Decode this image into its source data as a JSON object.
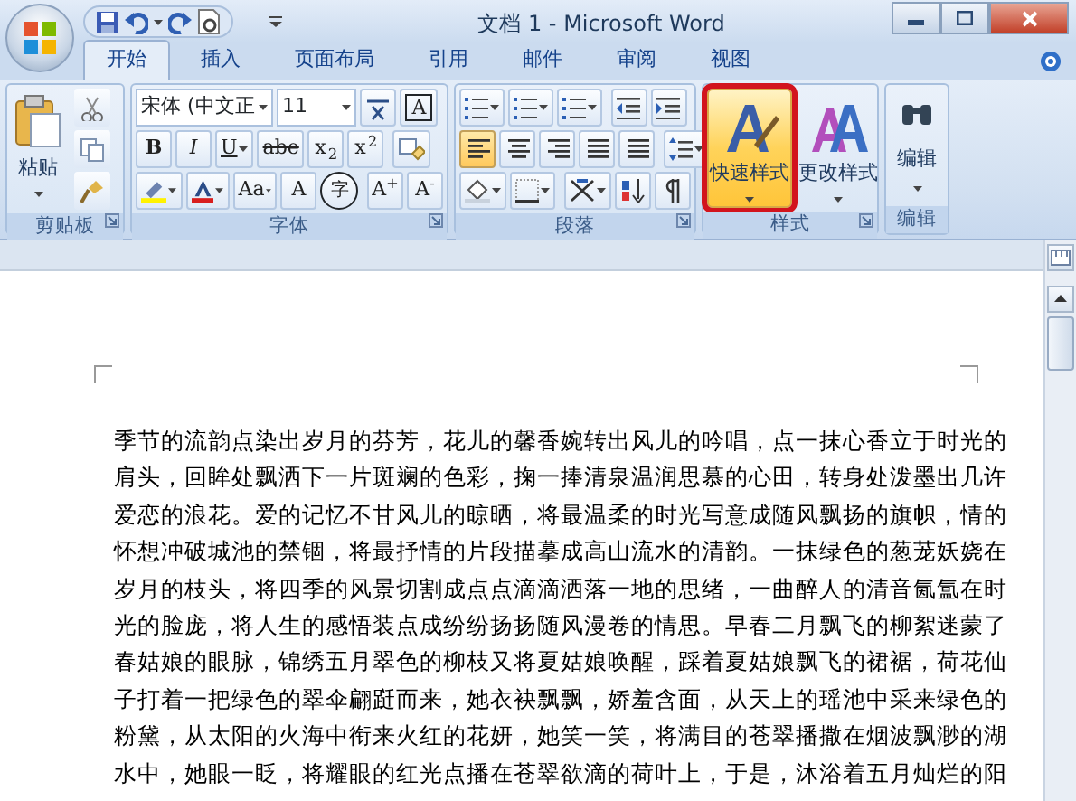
{
  "window": {
    "title": "文档 1 - Microsoft Word"
  },
  "tabs": [
    {
      "label": "开始",
      "selected": true
    },
    {
      "label": "插入",
      "selected": false
    },
    {
      "label": "页面布局",
      "selected": false
    },
    {
      "label": "引用",
      "selected": false
    },
    {
      "label": "邮件",
      "selected": false
    },
    {
      "label": "审阅",
      "selected": false
    },
    {
      "label": "视图",
      "selected": false
    }
  ],
  "ribbon": {
    "clipboard": {
      "label": "剪贴板",
      "paste_label": "粘贴"
    },
    "font": {
      "label": "字体",
      "font_name": "宋体 (中文正",
      "font_size": "11",
      "box_button": "A",
      "format_buttons": [
        "B",
        "I",
        "U",
        "abe",
        "x$_{2}$",
        "x$^{2}$"
      ],
      "effect_buttons": [
        "Aa",
        "A",
        "字",
        "A$^{+}$",
        "A$^{-}$"
      ]
    },
    "paragraph": {
      "label": "段落",
      "align_buttons": [
        {
          "selected": true
        },
        {
          "selected": false
        },
        {
          "selected": false
        },
        {
          "selected": false
        },
        {
          "selected": false
        }
      ]
    },
    "styles": {
      "label": "样式",
      "buttons": [
        {
          "label": "快速样式",
          "selected": true,
          "annotated": true
        },
        {
          "label": "更改样式",
          "selected": false,
          "annotated": false
        }
      ]
    },
    "editing": {
      "label": "编辑",
      "button_label": "编辑"
    }
  },
  "document": {
    "lines": [
      "季节的流韵点染出岁月的芬芳，花儿的馨香婉转出风儿的吟唱，点一抹心香立于时光的",
      "肩头，回眸处飘洒下一片斑斓的色彩，掬一捧清泉温润思慕的心田，转身处泼墨出几许",
      "爱恋的浪花。爱的记忆不甘风儿的晾晒，将最温柔的时光写意成随风飘扬的旗帜，情的",
      "怀想冲破城池的禁锢，将最抒情的片段描摹成高山流水的清韵。一抹绿色的葱茏妖娆在",
      "岁月的枝头，将四季的风景切割成点点滴滴洒落一地的思绪，一曲醉人的清音氤氲在时",
      "光的脸庞，将人生的感悟装点成纷纷扬扬随风漫卷的情思。早春二月飘飞的柳絮迷蒙了",
      "春姑娘的眼脉，锦绣五月翠色的柳枝又将夏姑娘唤醒，踩着夏姑娘飘飞的裙裾，荷花仙",
      "子打着一把绿色的翠伞翩跹而来，她衣袂飘飘，娇羞含面，从天上的瑶池中采来绿色的",
      "粉黛，从太阳的火海中衔来火红的花妍，她笑一笑，将满目的苍翠播撒在烟波飘渺的湖",
      "水中，她眼一眨，将耀眼的红光点播在苍翠欲滴的荷叶上，于是，沐浴着五月灿烂的阳"
    ]
  }
}
